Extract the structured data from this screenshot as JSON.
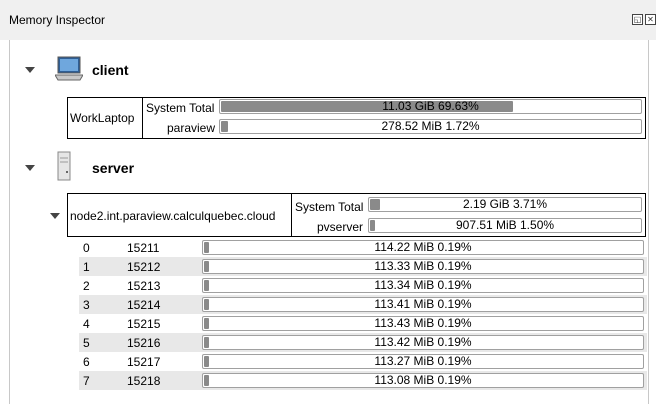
{
  "window": {
    "title": "Memory Inspector"
  },
  "client": {
    "label": "client",
    "host": "WorkLaptop",
    "system_total": {
      "label": "System Total",
      "text": "11.03 GiB 69.63%",
      "fraction": 0.6963
    },
    "process": {
      "label": "paraview",
      "text": "278.52 MiB 1.72%",
      "fraction": 0.0172
    }
  },
  "server": {
    "label": "server",
    "host": "node2.int.paraview.calculquebec.cloud",
    "system_total": {
      "label": "System Total",
      "text": "2.19 GiB 3.71%",
      "fraction": 0.0371
    },
    "process": {
      "label": "pvserver",
      "text": "907.51 MiB 1.50%",
      "fraction": 0.015
    },
    "ranks": [
      {
        "rank": "0",
        "pid": "15211",
        "text": "114.22 MiB 0.19%",
        "fraction": 0.0019
      },
      {
        "rank": "1",
        "pid": "15212",
        "text": "113.33 MiB 0.19%",
        "fraction": 0.0019
      },
      {
        "rank": "2",
        "pid": "15213",
        "text": "113.34 MiB 0.19%",
        "fraction": 0.0019
      },
      {
        "rank": "3",
        "pid": "15214",
        "text": "113.41 MiB 0.19%",
        "fraction": 0.0019
      },
      {
        "rank": "4",
        "pid": "15215",
        "text": "113.43 MiB 0.19%",
        "fraction": 0.0019
      },
      {
        "rank": "5",
        "pid": "15216",
        "text": "113.42 MiB 0.19%",
        "fraction": 0.0019
      },
      {
        "rank": "6",
        "pid": "15217",
        "text": "113.27 MiB 0.19%",
        "fraction": 0.0019
      },
      {
        "rank": "7",
        "pid": "15218",
        "text": "113.08 MiB 0.19%",
        "fraction": 0.0019
      }
    ]
  }
}
